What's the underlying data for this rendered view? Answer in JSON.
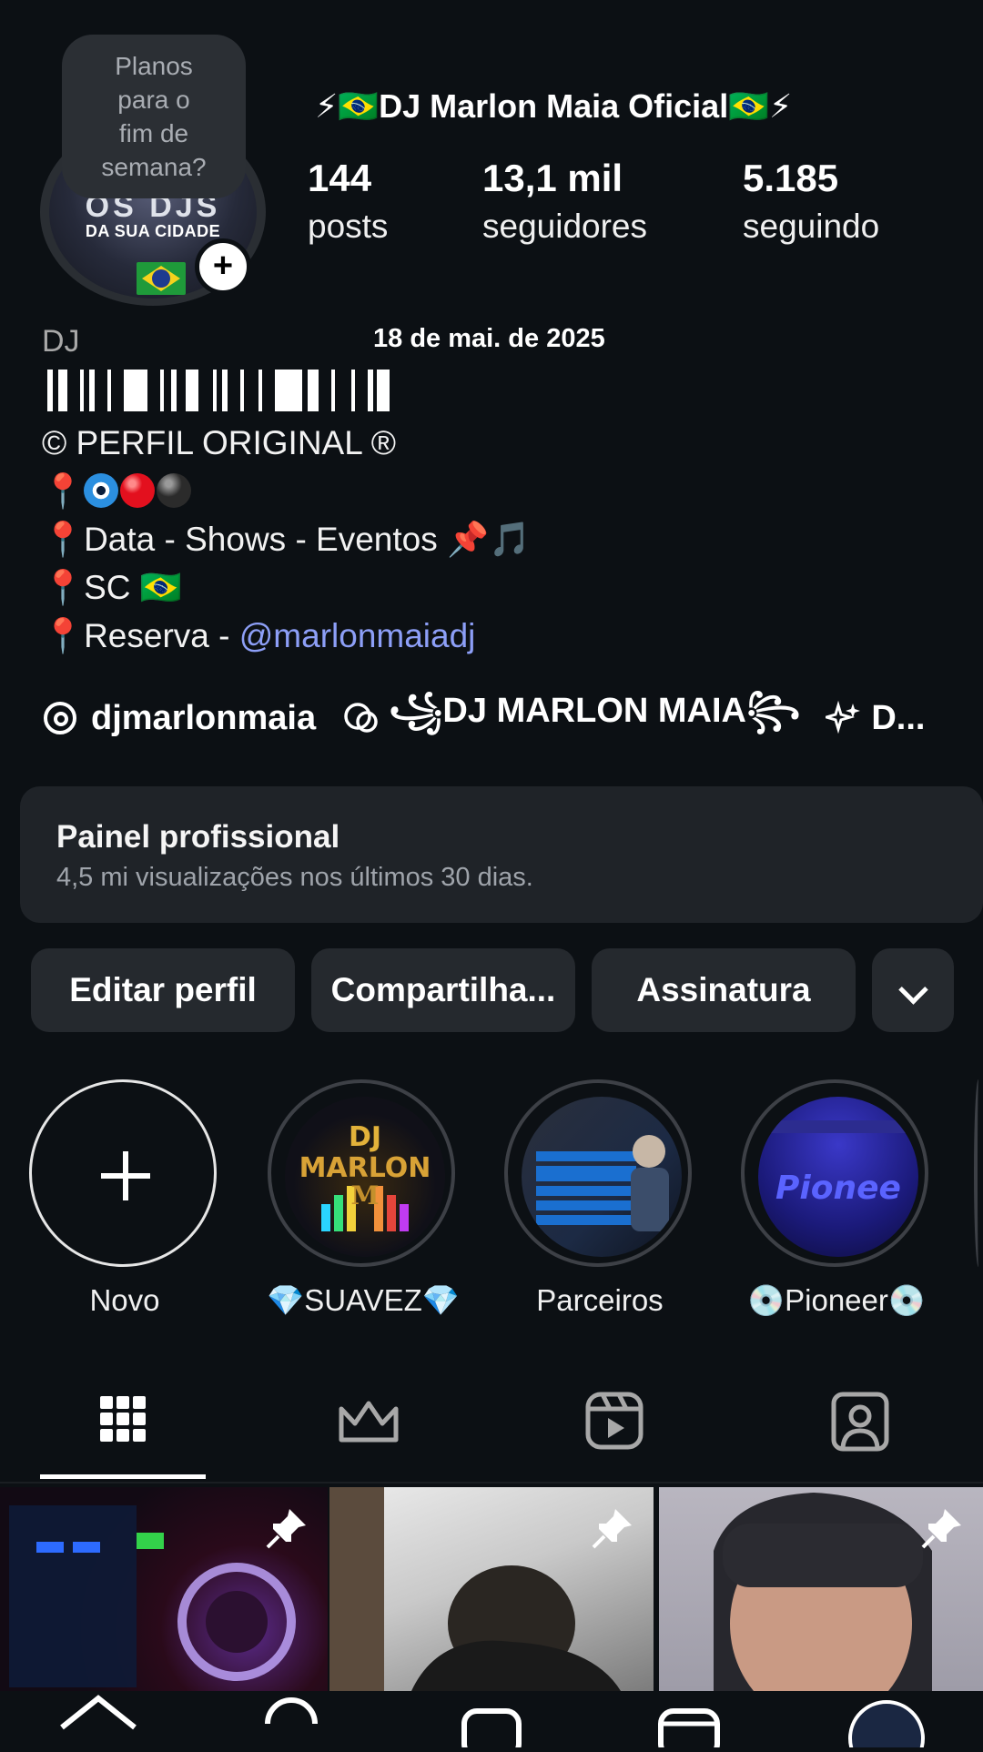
{
  "profile": {
    "name": "⚡🇧🇷DJ Marlon Maia Oficial🇧🇷⚡",
    "note": [
      "Planos",
      "para o",
      "fim de",
      "semana?"
    ],
    "avatar_text_big": "OS DJS",
    "avatar_text": "DA SUA CIDADE",
    "add_story": "+"
  },
  "stats": {
    "posts_value": "144",
    "posts_label": "posts",
    "followers_value": "13,1 mil",
    "followers_label": "seguidores",
    "following_value": "5.185",
    "following_label": "seguindo"
  },
  "bio": {
    "category": "DJ",
    "date": "18 de mai. de 2025",
    "line1": "  © PERFIL ORIGINAL ®",
    "line2_prefix": "📍",
    "line3": "📍Data - Shows - Eventos 📌🎵",
    "line4": "📍SC 🇧🇷",
    "line5_prefix": "📍Reserva - ",
    "line5_link": "@marlonmaiadj"
  },
  "links": {
    "threads_handle": "djmarlonmaia",
    "link2": "꧁DJ MARLON MAIA꧂",
    "link3": "D..."
  },
  "panel": {
    "title": "Painel profissional",
    "subtitle": "4,5 mi visualizações nos últimos 30 dias."
  },
  "actions": {
    "edit": "Editar perfil",
    "share": "Compartilha...",
    "subscription": "Assinatura"
  },
  "highlights": [
    {
      "label": "Novo"
    },
    {
      "label": "💎SUAVEZ💎"
    },
    {
      "label": "Parceiros"
    },
    {
      "label": "💿Pioneer💿"
    }
  ],
  "tabs": [
    "grid",
    "subscriptions",
    "reels",
    "tagged"
  ],
  "colors": {
    "background": "#0c1014",
    "surface": "#25292e",
    "link": "#8d9ff7"
  }
}
